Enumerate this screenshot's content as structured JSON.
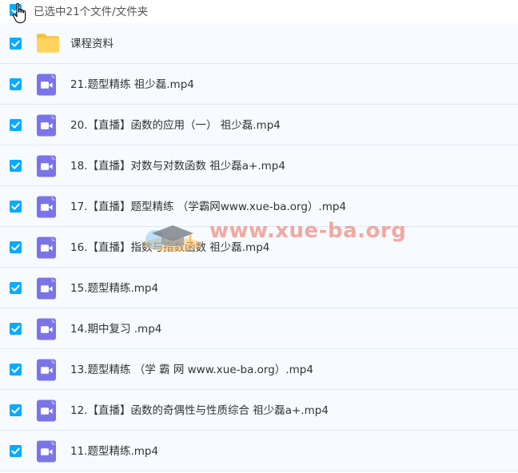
{
  "header": {
    "selection_text": "已选中21个文件/文件夹"
  },
  "colors": {
    "checkbox": "#09aaff",
    "folder": "#ffd35c",
    "video_icon": "#7b74e8",
    "row_bg": "#f7fafe",
    "row_border": "#dfe9f5"
  },
  "files": [
    {
      "name": "课程资料",
      "icon": "folder-icon"
    },
    {
      "name": "21.题型精练 祖少磊.mp4",
      "icon": "video-file-icon"
    },
    {
      "name": "20.【直播】函数的应用（一） 祖少磊.mp4",
      "icon": "video-file-icon"
    },
    {
      "name": "18.【直播】对数与对数函数 祖少磊a+.mp4",
      "icon": "video-file-icon"
    },
    {
      "name": "17.【直播】题型精练 （学霸网www.xue-ba.org）.mp4",
      "icon": "video-file-icon"
    },
    {
      "name": "16.【直播】指数与指数函数 祖少磊.mp4",
      "icon": "video-file-icon"
    },
    {
      "name": "15.题型精练.mp4",
      "icon": "video-file-icon"
    },
    {
      "name": "14.期中复习 .mp4",
      "icon": "video-file-icon"
    },
    {
      "name": "13.题型精练 （学 霸 网 www.xue-ba.org）.mp4",
      "icon": "video-file-icon"
    },
    {
      "name": "12.【直播】函数的奇偶性与性质综合 祖少磊a+.mp4",
      "icon": "video-file-icon"
    },
    {
      "name": "11.题型精练.mp4",
      "icon": "video-file-icon"
    }
  ],
  "watermark": {
    "text": "www.xue-ba.org"
  }
}
